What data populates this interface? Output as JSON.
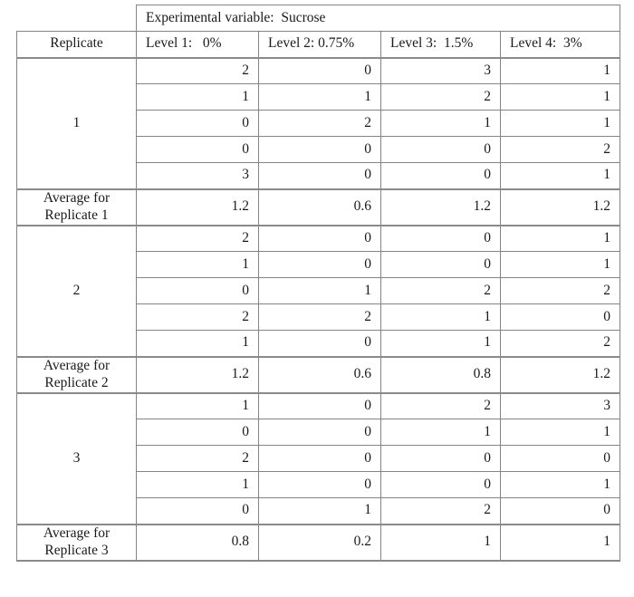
{
  "table": {
    "corner_blank": "",
    "experimental_variable_header": "Experimental variable:  Sucrose",
    "replicate_header": "Replicate",
    "level_headers": [
      "Level 1:   0%",
      "Level 2: 0.75%",
      "Level 3:  1.5%",
      "Level 4:  3%"
    ],
    "blocks": [
      {
        "replicate_label": "1",
        "rows": [
          [
            "2",
            "0",
            "3",
            "1"
          ],
          [
            "1",
            "1",
            "2",
            "1"
          ],
          [
            "0",
            "2",
            "1",
            "1"
          ],
          [
            "0",
            "0",
            "0",
            "2"
          ],
          [
            "3",
            "0",
            "0",
            "1"
          ]
        ],
        "average_label_line1": "Average for",
        "average_label_line2": "Replicate 1",
        "averages": [
          "1.2",
          "0.6",
          "1.2",
          "1.2"
        ]
      },
      {
        "replicate_label": "2",
        "rows": [
          [
            "2",
            "0",
            "0",
            "1"
          ],
          [
            "1",
            "0",
            "0",
            "1"
          ],
          [
            "0",
            "1",
            "2",
            "2"
          ],
          [
            "2",
            "2",
            "1",
            "0"
          ],
          [
            "1",
            "0",
            "1",
            "2"
          ]
        ],
        "average_label_line1": "Average for",
        "average_label_line2": "Replicate 2",
        "averages": [
          "1.2",
          "0.6",
          "0.8",
          "1.2"
        ]
      },
      {
        "replicate_label": "3",
        "rows": [
          [
            "1",
            "0",
            "2",
            "3"
          ],
          [
            "0",
            "0",
            "1",
            "1"
          ],
          [
            "2",
            "0",
            "0",
            "0"
          ],
          [
            "1",
            "0",
            "0",
            "1"
          ],
          [
            "0",
            "1",
            "2",
            "0"
          ]
        ],
        "average_label_line1": "Average for",
        "average_label_line2": "Replicate 3",
        "averages": [
          "0.8",
          "0.2",
          "1",
          "1"
        ]
      }
    ]
  },
  "colors": {
    "border": "#848484",
    "border_strong": "#8a8a8a",
    "text": "#1a1a1a",
    "background": "#ffffff"
  }
}
